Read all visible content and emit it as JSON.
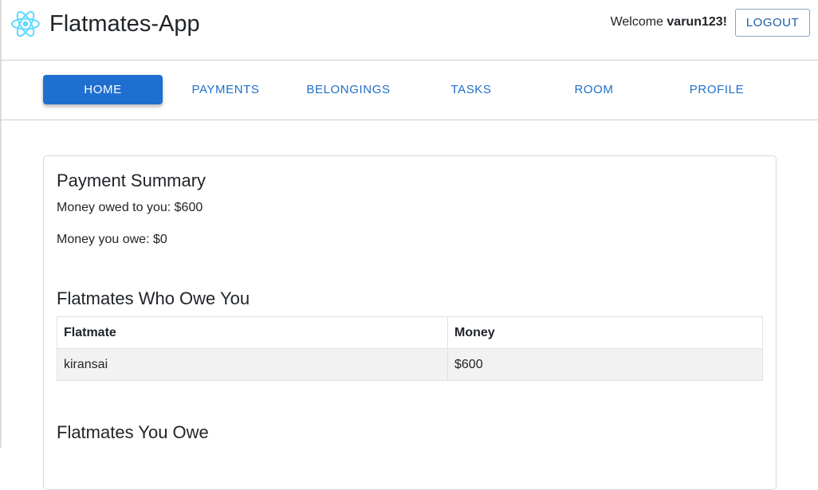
{
  "app": {
    "title": "Flatmates-App",
    "logo_icon": "react-atom-icon",
    "accent": "#1f6fd0",
    "logo_color": "#61dafb"
  },
  "header": {
    "welcome_prefix": "Welcome",
    "username": "varun123!",
    "logout_label": "LOGOUT"
  },
  "nav": {
    "active": "HOME",
    "tabs": [
      {
        "label": "HOME"
      },
      {
        "label": "PAYMENTS"
      },
      {
        "label": "BELONGINGS"
      },
      {
        "label": "TASKS"
      },
      {
        "label": "ROOM"
      },
      {
        "label": "PROFILE"
      }
    ]
  },
  "summary": {
    "title": "Payment Summary",
    "owed_to_you": "Money owed to you: $600",
    "you_owe": "Money you owe: $0"
  },
  "owe_you": {
    "title": "Flatmates Who Owe You",
    "columns": [
      "Flatmate",
      "Money"
    ],
    "rows": [
      {
        "flatmate": "kiransai",
        "money": "$600"
      }
    ]
  },
  "you_owe": {
    "title": "Flatmates You Owe"
  }
}
